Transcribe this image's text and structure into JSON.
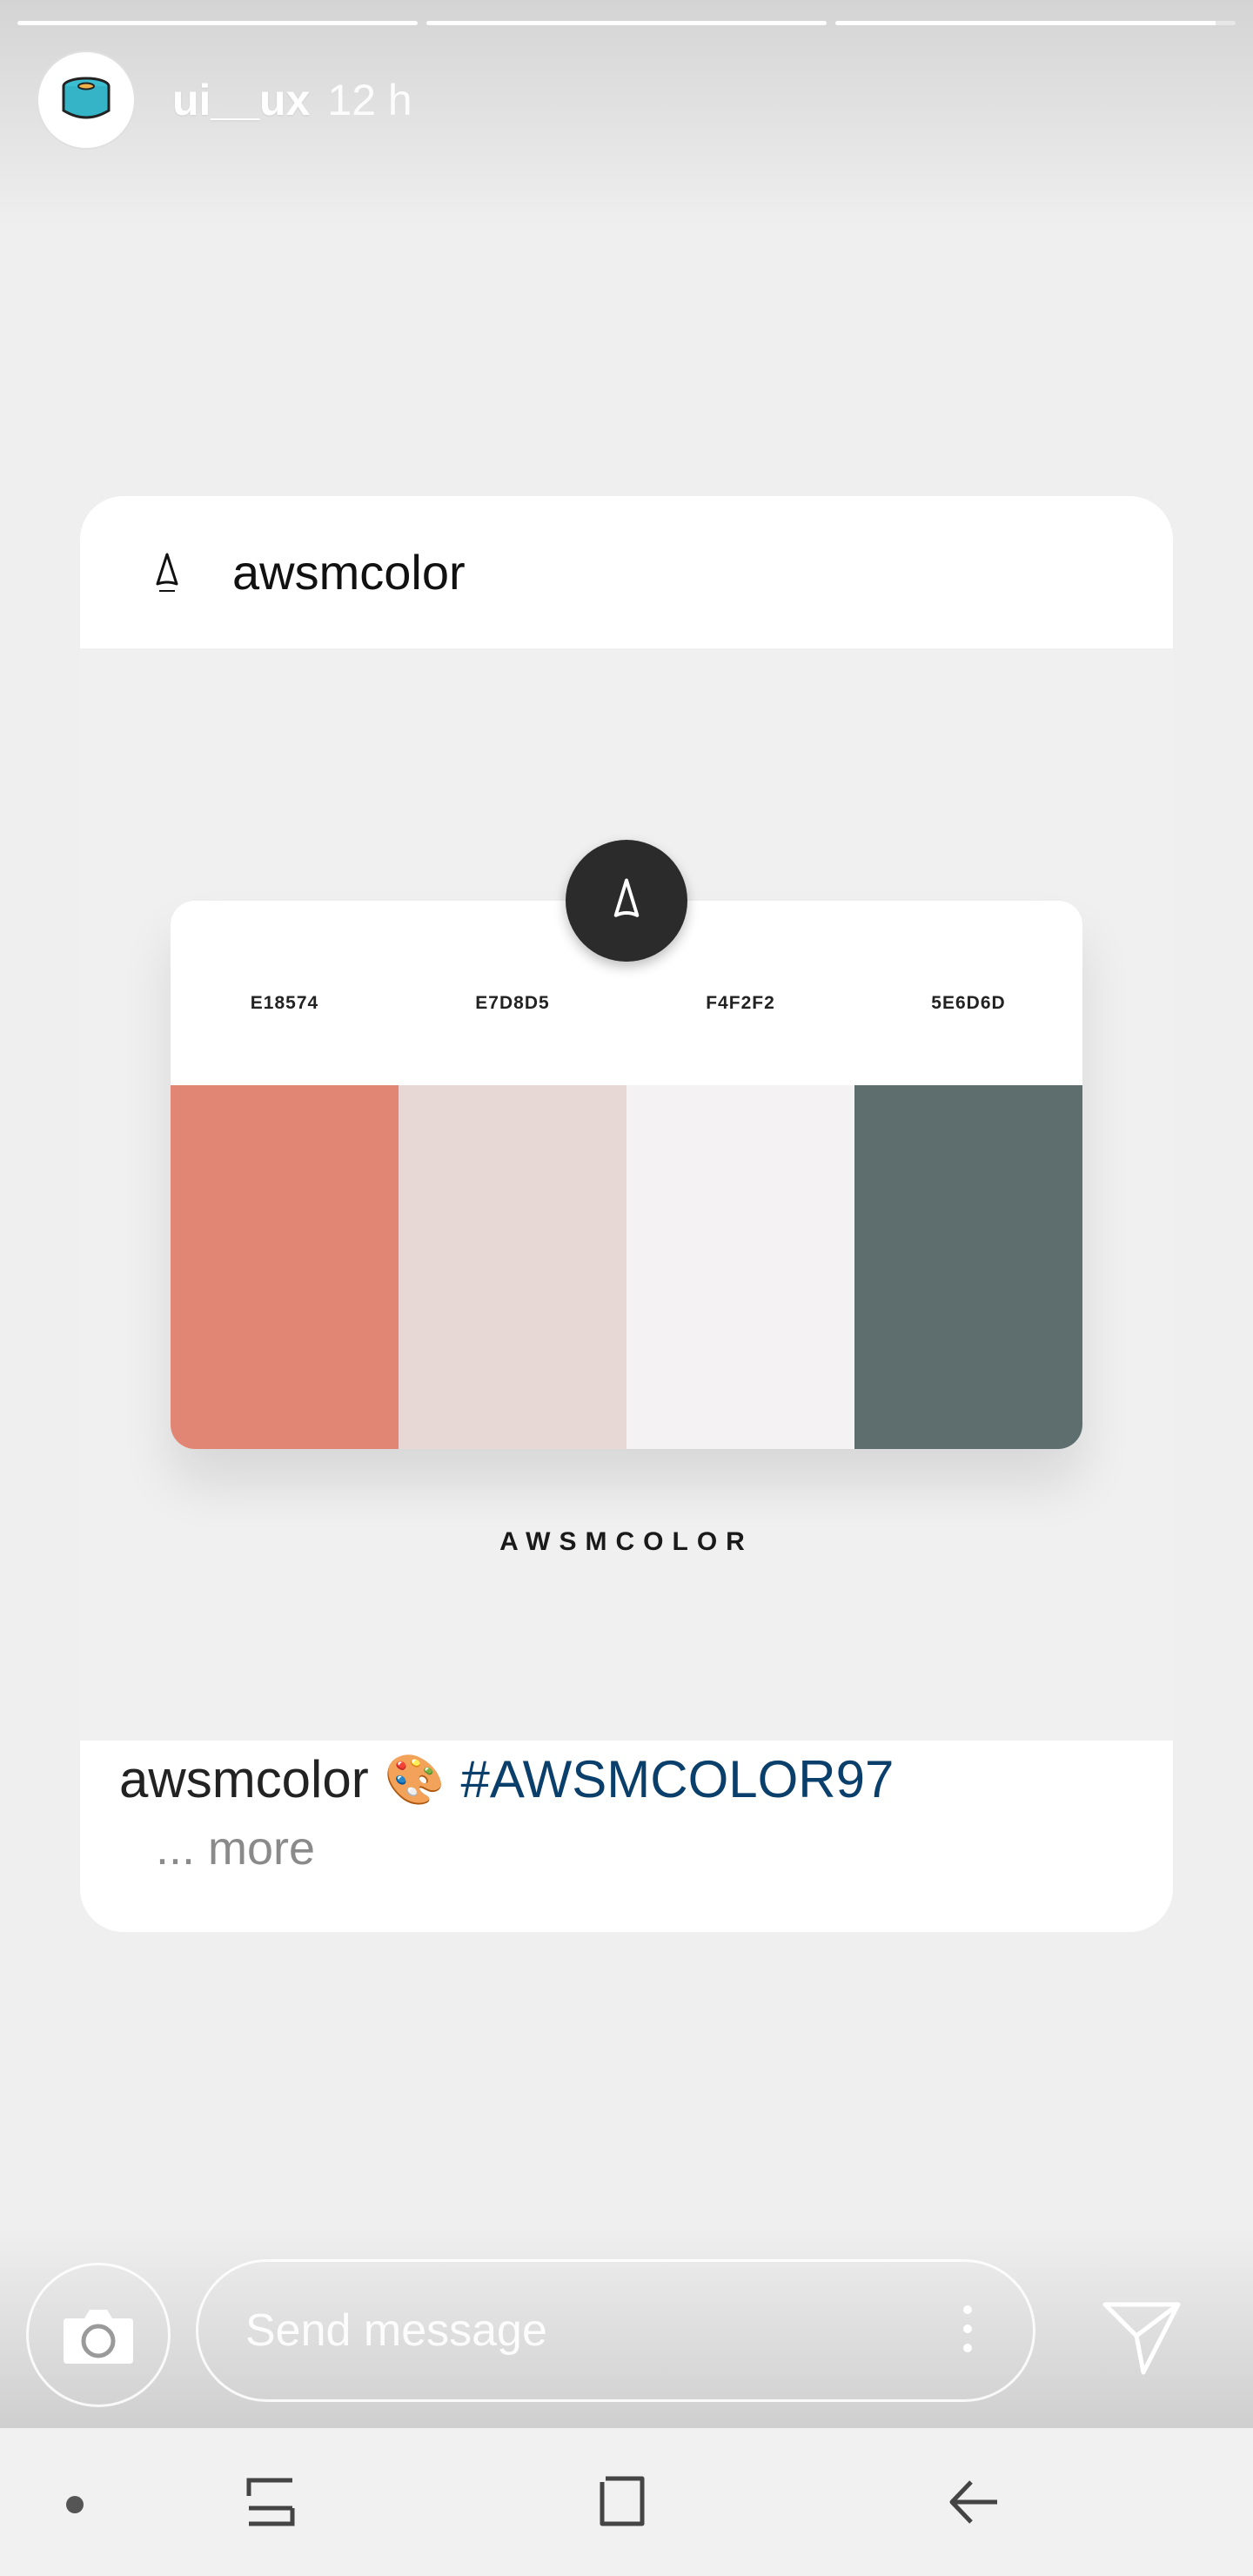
{
  "story": {
    "username": "ui__ux",
    "time": "12 h",
    "progress_segments": 3
  },
  "post": {
    "author": "awsmcolor",
    "palette": [
      {
        "code": "E18574",
        "color": "#e18574"
      },
      {
        "code": "E7D8D5",
        "color": "#e7d8d5"
      },
      {
        "code": "F4F2F2",
        "color": "#f4f2f2"
      },
      {
        "code": "5E6D6D",
        "color": "#5e6d6d"
      }
    ],
    "wordmark": "AWSMCOLOR",
    "caption": {
      "author": "awsmcolor",
      "emoji": "🎨",
      "hashtag": "#AWSMCOLOR97",
      "more": "... more"
    }
  },
  "reply": {
    "placeholder": "Send message"
  },
  "icons": {
    "camera": "camera-icon",
    "send": "send-icon",
    "more": "more-vertical-icon"
  }
}
